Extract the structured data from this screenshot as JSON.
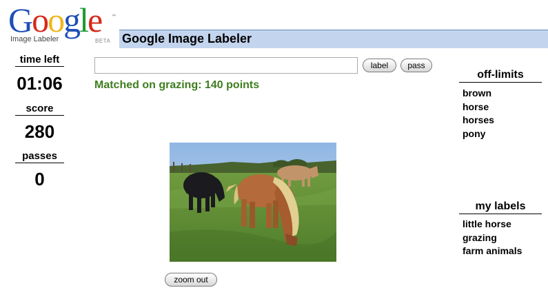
{
  "logo": {
    "letters": [
      "G",
      "o",
      "o",
      "g",
      "l",
      "e"
    ],
    "letter_colors": [
      "#1f4fb8",
      "#d62a19",
      "#f0b51c",
      "#1f4fb8",
      "#1e9a33",
      "#d62a19"
    ],
    "subtitle": "Image Labeler",
    "beta": "BETA",
    "tm": "™"
  },
  "header": {
    "title": "Google Image Labeler"
  },
  "stats": {
    "time_left_label": "time left",
    "time_left_value": "01:06",
    "score_label": "score",
    "score_value": "280",
    "passes_label": "passes",
    "passes_value": "0"
  },
  "controls": {
    "input_value": "",
    "label_button": "label",
    "pass_button": "pass",
    "zoom_button": "zoom out"
  },
  "status_message": "Matched on grazing: 140 points",
  "off_limits": {
    "heading": "off-limits",
    "items": [
      "brown",
      "horse",
      "horses",
      "pony"
    ]
  },
  "my_labels": {
    "heading": "my labels",
    "items": [
      "little horse",
      "grazing",
      "farm animals"
    ]
  },
  "colors": {
    "title_bar": "#c3d4ee",
    "status_text": "#3e7d1e"
  }
}
